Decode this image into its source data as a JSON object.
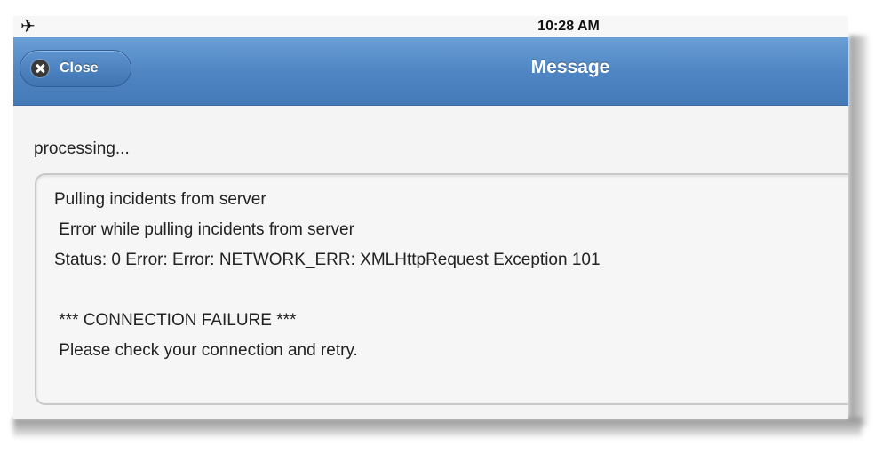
{
  "status_bar": {
    "airplane_glyph": "✈",
    "time": "10:28 AM"
  },
  "header": {
    "close_label": "Close",
    "title": "Message"
  },
  "content": {
    "status_text": "processing...",
    "message_lines": [
      "Pulling incidents from server",
      " Error while pulling incidents from server",
      "Status: 0 Error: Error: NETWORK_ERR: XMLHttpRequest Exception 101",
      "",
      " *** CONNECTION FAILURE ***",
      " Please check your connection and retry."
    ]
  },
  "colors": {
    "header_blue": "#4f86c3",
    "page_background": "#f4f4f4"
  }
}
